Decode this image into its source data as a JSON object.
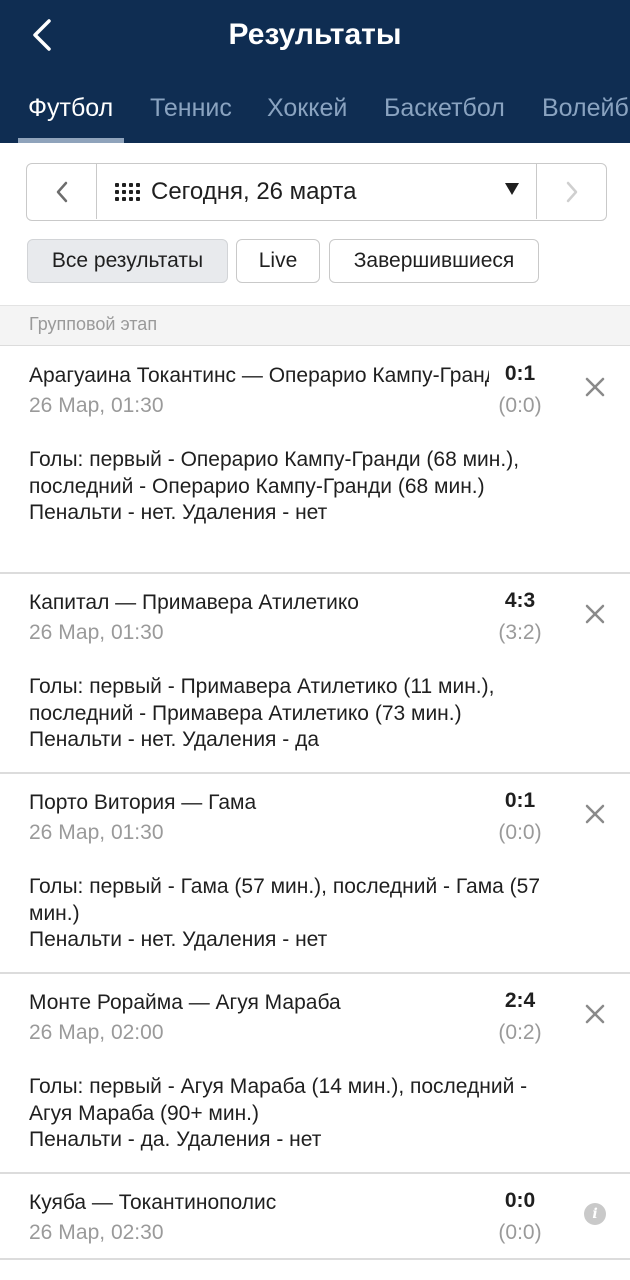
{
  "header": {
    "title": "Результаты",
    "tabs": [
      {
        "label": "Футбол"
      },
      {
        "label": "Теннис"
      },
      {
        "label": "Хоккей"
      },
      {
        "label": "Баскетбол"
      },
      {
        "label": "Волейб"
      }
    ]
  },
  "date_bar": {
    "date": "Сегодня, 26 марта"
  },
  "filters": [
    {
      "label": "Все результаты"
    },
    {
      "label": "Live"
    },
    {
      "label": "Завершившиеся"
    }
  ],
  "section": {
    "title": "Групповой этап"
  },
  "matches": [
    {
      "teams": "Арагуаина Токантинс — Операрио Кампу-Гранди",
      "score": "0:1",
      "datetime": "26 Мар, 01:30",
      "halftime": "(0:0)",
      "goals": "Голы: первый - Операрио Кампу-Гранди (68 мин.), последний - Операрио Кампу-Гранди (68 мин.)",
      "penalties": "Пенальти - нет. Удаления - нет"
    },
    {
      "teams": "Капитал — Примавера Атилетико",
      "score": "4:3",
      "datetime": "26 Мар, 01:30",
      "halftime": "(3:2)",
      "goals": "Голы: первый - Примавера Атилетико (11 мин.), последний - Примавера Атилетико (73 мин.)",
      "penalties": "Пенальти - нет. Удаления - да"
    },
    {
      "teams": "Порто Витория — Гама",
      "score": "0:1",
      "datetime": "26 Мар, 01:30",
      "halftime": "(0:0)",
      "goals": "Голы: первый - Гама (57 мин.), последний - Гама (57 мин.)",
      "penalties": "Пенальти - нет. Удаления - нет"
    },
    {
      "teams": "Монте Рорайма — Агуя Мараба",
      "score": "2:4",
      "datetime": "26 Мар, 02:00",
      "halftime": "(0:2)",
      "goals": "Голы: первый - Агуя Мараба (14 мин.), последний - Агуя Мараба (90+ мин.)",
      "penalties": "Пенальти - да. Удаления - нет"
    },
    {
      "teams": "Куяба — Токантинополис",
      "score": "0:0",
      "datetime": "26 Мар, 02:30",
      "halftime": "(0:0)",
      "info_icon": "i"
    }
  ],
  "colors": {
    "header_bg": "#0f2d52",
    "tab_inactive": "#8aa3c0",
    "muted_text": "#9a9a9a"
  },
  "icons": {
    "back": "chevron-left-icon",
    "prev": "chevron-left-icon",
    "next": "chevron-right-icon",
    "calendar": "dots-grid-icon",
    "dropdown": "caret-down-icon",
    "close": "close-icon",
    "info": "info-icon"
  }
}
